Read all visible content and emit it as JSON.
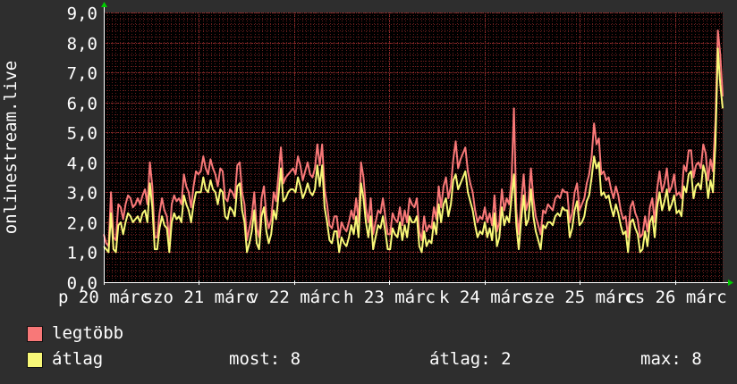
{
  "chart_data": {
    "type": "line",
    "ylabel": "onlinestream.live",
    "ylim": [
      0,
      9
    ],
    "yticks": [
      "0,0",
      "1,0",
      "2,0",
      "3,0",
      "4,0",
      "5,0",
      "6,0",
      "7,0",
      "8,0",
      "9,0"
    ],
    "xtick_labels": [
      "p 20 márc",
      "szo 21 márc",
      "v 22 márc",
      "h 23 márc",
      "k 24 márc",
      "sze 25 márc",
      "cs 26 márc"
    ],
    "grid": true,
    "series": [
      {
        "name": "legtöbb",
        "color": "#f87878",
        "values": [
          1.6,
          1.3,
          1.2,
          3.0,
          1.5,
          1.4,
          2.6,
          2.5,
          2.1,
          2.6,
          2.9,
          2.8,
          2.5,
          2.6,
          2.8,
          2.6,
          2.9,
          3.1,
          2.6,
          4.0,
          3.2,
          1.5,
          1.5,
          2.3,
          2.8,
          2.4,
          2.2,
          1.4,
          2.6,
          2.9,
          2.7,
          2.8,
          2.6,
          3.6,
          3.2,
          3.0,
          2.5,
          3.2,
          3.7,
          3.6,
          3.7,
          4.2,
          3.8,
          3.6,
          4.1,
          3.8,
          3.6,
          3.2,
          3.8,
          3.7,
          2.8,
          2.7,
          3.1,
          3.0,
          2.8,
          3.9,
          4.0,
          3.0,
          2.6,
          1.4,
          1.8,
          2.2,
          3.0,
          1.8,
          1.5,
          2.8,
          3.2,
          2.2,
          1.8,
          2.1,
          3.0,
          2.7,
          3.6,
          4.5,
          3.3,
          3.5,
          3.6,
          3.7,
          3.8,
          3.6,
          4.2,
          3.9,
          3.4,
          3.7,
          4.0,
          3.6,
          3.5,
          3.8,
          4.6,
          3.9,
          4.6,
          3.1,
          2.6,
          1.9,
          1.8,
          2.2,
          2.2,
          1.5,
          2.0,
          1.8,
          1.7,
          2.0,
          2.4,
          2.1,
          2.8,
          2.0,
          4.0,
          3.5,
          2.5,
          2.0,
          2.8,
          1.6,
          2.0,
          2.4,
          2.3,
          2.8,
          2.2,
          1.6,
          1.6,
          2.3,
          2.1,
          2.0,
          2.5,
          1.9,
          2.4,
          2.0,
          2.8,
          2.6,
          2.5,
          2.8,
          1.7,
          1.4,
          2.2,
          1.7,
          1.9,
          1.8,
          2.5,
          2.1,
          3.2,
          2.5,
          3.2,
          3.5,
          2.8,
          3.2,
          4.1,
          4.7,
          3.8,
          4.1,
          4.3,
          4.5,
          3.7,
          3.3,
          3.0,
          2.4,
          2.0,
          2.2,
          2.1,
          2.5,
          2.0,
          2.3,
          1.9,
          2.9,
          1.7,
          2.0,
          3.1,
          2.4,
          2.8,
          2.6,
          3.4,
          5.8,
          2.4,
          1.6,
          2.7,
          3.6,
          2.4,
          2.7,
          3.8,
          2.8,
          2.2,
          1.9,
          1.6,
          2.4,
          2.3,
          2.6,
          2.5,
          2.4,
          2.8,
          2.9,
          2.8,
          3.1,
          3.0,
          3.0,
          2.0,
          2.3,
          3.0,
          3.3,
          2.4,
          2.6,
          2.8,
          3.3,
          3.6,
          4.2,
          5.3,
          4.6,
          4.8,
          3.6,
          3.7,
          3.4,
          3.5,
          3.1,
          2.8,
          3.2,
          2.9,
          2.4,
          2.1,
          2.2,
          1.5,
          2.5,
          2.7,
          2.3,
          2.1,
          1.5,
          1.6,
          2.2,
          1.7,
          2.5,
          2.8,
          2.0,
          3.1,
          3.7,
          3.0,
          3.3,
          3.8,
          3.0,
          3.2,
          3.6,
          2.9,
          3.0,
          2.8,
          3.9,
          3.7,
          4.4,
          4.4,
          3.5,
          3.9,
          4.0,
          3.8,
          4.6,
          4.3,
          3.4,
          4.1,
          3.7,
          5.4,
          8.4,
          7.6,
          6.2
        ]
      },
      {
        "name": "átlag",
        "color": "#f8f878",
        "values": [
          1.2,
          1.1,
          1.0,
          2.3,
          1.1,
          1.0,
          1.9,
          2.0,
          1.6,
          2.0,
          2.3,
          2.2,
          2.0,
          2.1,
          2.2,
          2.0,
          2.3,
          2.4,
          2.0,
          3.3,
          2.5,
          1.1,
          1.1,
          1.8,
          2.2,
          1.9,
          1.8,
          1.0,
          2.0,
          2.3,
          2.1,
          2.2,
          2.0,
          2.9,
          2.6,
          2.4,
          2.0,
          2.6,
          3.0,
          3.0,
          3.0,
          3.5,
          3.1,
          3.0,
          3.4,
          3.1,
          3.0,
          2.6,
          3.1,
          3.0,
          2.2,
          2.1,
          2.5,
          2.4,
          2.2,
          3.2,
          3.3,
          2.4,
          2.0,
          1.0,
          1.3,
          1.7,
          2.4,
          1.3,
          1.1,
          2.2,
          2.5,
          1.7,
          1.3,
          1.6,
          2.4,
          2.1,
          2.9,
          3.8,
          2.7,
          2.8,
          3.0,
          3.1,
          3.1,
          3.0,
          3.5,
          3.2,
          2.8,
          3.0,
          3.3,
          3.0,
          2.9,
          3.1,
          3.9,
          3.2,
          3.9,
          2.5,
          2.0,
          1.4,
          1.3,
          1.7,
          1.7,
          1.0,
          1.5,
          1.3,
          1.2,
          1.5,
          1.9,
          1.6,
          2.2,
          1.5,
          3.3,
          2.8,
          2.0,
          1.5,
          2.2,
          1.1,
          1.5,
          1.9,
          1.8,
          2.2,
          1.7,
          1.1,
          1.1,
          1.8,
          1.6,
          1.5,
          2.0,
          1.4,
          1.9,
          1.5,
          2.2,
          2.0,
          2.0,
          2.2,
          1.2,
          1.0,
          1.7,
          1.2,
          1.4,
          1.3,
          2.0,
          1.6,
          2.6,
          2.0,
          2.6,
          2.8,
          2.2,
          2.6,
          3.4,
          3.6,
          3.1,
          3.3,
          3.5,
          3.7,
          3.0,
          2.7,
          2.4,
          1.9,
          1.5,
          1.7,
          1.6,
          2.0,
          1.5,
          1.8,
          1.4,
          2.3,
          1.2,
          1.5,
          2.5,
          1.9,
          2.2,
          2.0,
          2.8,
          3.6,
          1.9,
          1.1,
          2.1,
          2.9,
          1.9,
          2.1,
          3.1,
          2.2,
          1.7,
          1.4,
          1.1,
          1.9,
          1.8,
          2.0,
          2.0,
          1.9,
          2.2,
          2.3,
          2.2,
          2.5,
          2.4,
          2.4,
          1.5,
          1.8,
          2.4,
          2.7,
          1.9,
          2.0,
          2.2,
          2.7,
          2.9,
          3.5,
          4.2,
          3.8,
          4.0,
          2.9,
          3.0,
          2.8,
          2.9,
          2.5,
          2.2,
          2.6,
          2.3,
          1.9,
          1.6,
          1.7,
          1.0,
          2.0,
          2.1,
          1.8,
          1.6,
          1.0,
          1.1,
          1.7,
          1.2,
          2.0,
          2.2,
          1.5,
          2.5,
          3.0,
          2.4,
          2.7,
          3.1,
          2.4,
          2.6,
          2.9,
          2.3,
          2.4,
          2.2,
          3.2,
          3.0,
          3.6,
          3.7,
          2.8,
          3.2,
          3.3,
          3.1,
          3.9,
          3.6,
          2.8,
          3.4,
          3.0,
          4.6,
          7.8,
          6.6,
          5.8
        ]
      }
    ],
    "legend_position": "bottom-left"
  },
  "legend": {
    "items": [
      {
        "label": "legtöbb",
        "color": "#f87878"
      },
      {
        "label": "átlag",
        "color": "#f8f878"
      }
    ],
    "stats": {
      "current": "most: 8",
      "average": "átlag: 2",
      "maximum": "max: 8"
    }
  },
  "colors": {
    "background": "#2e2e2e",
    "plot_background": "#000000",
    "minor_grid": "#6a1e1e",
    "major_grid": "#9a2e2e",
    "axis": "#ffffff",
    "arrow": "#00cc00",
    "text": "#ffffff"
  }
}
